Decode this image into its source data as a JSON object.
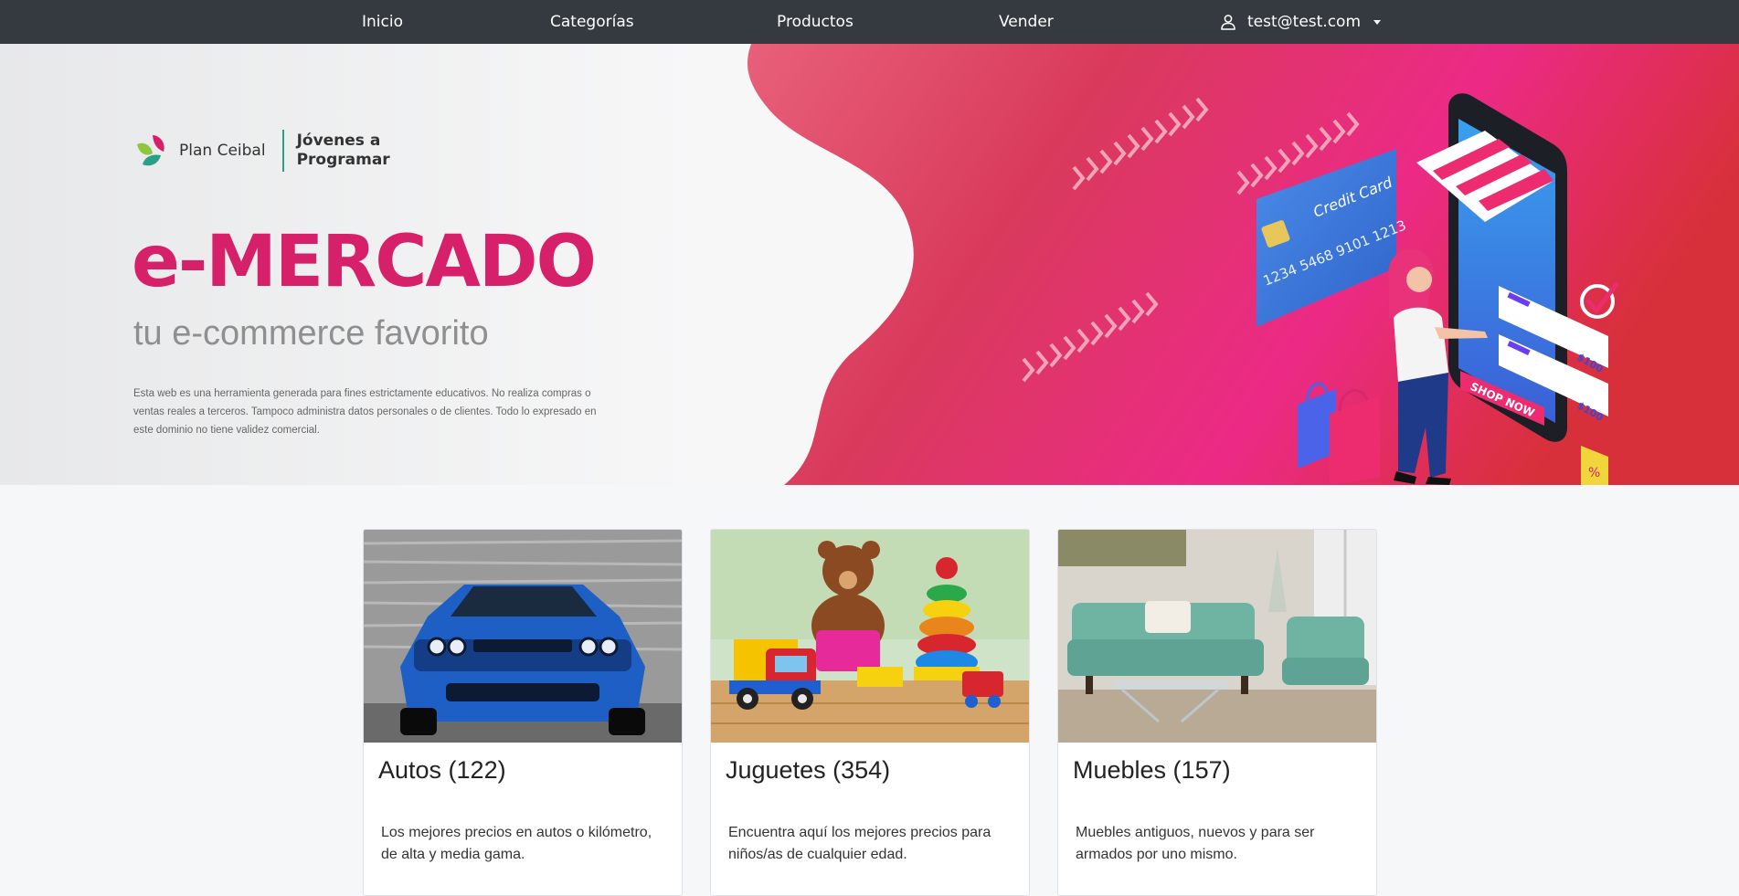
{
  "nav": {
    "items": [
      {
        "label": "Inicio"
      },
      {
        "label": "Categorías"
      },
      {
        "label": "Productos"
      },
      {
        "label": "Vender"
      }
    ],
    "user_email": "test@test.com"
  },
  "hero": {
    "brand_name": "Plan Ceibal",
    "brand_tag_line1": "Jóvenes a",
    "brand_tag_line2": "Programar",
    "title": "e-MERCADO",
    "subtitle": "tu e-commerce favorito",
    "description": "Esta web es una herramienta generada para fines estrictamente educativos. No realiza compras o ventas reales a terceros. Tampoco administra datos personales o de clientes. Todo lo expresado en este dominio no tiene validez comercial.",
    "illustration": {
      "card_label": "Credit Card",
      "card_number": "1234 5468 9101 1213",
      "shop_button": "SHOP NOW",
      "price1": "$100",
      "price2": "$100",
      "percent": "%"
    }
  },
  "categories": [
    {
      "title": "Autos (122)",
      "description": "Los mejores precios en autos o kilómetro, de alta y media gama."
    },
    {
      "title": "Juguetes (354)",
      "description": "Encuentra aquí los mejores precios para niños/as de cualquier edad."
    },
    {
      "title": "Muebles (157)",
      "description": "Muebles antiguos, nuevos y para ser armados por uno mismo."
    }
  ],
  "colors": {
    "navbar": "#343a40",
    "brand_pink": "#d6206a",
    "hero_gradient_start": "#e35a74",
    "hero_gradient_end": "#d8313f"
  }
}
